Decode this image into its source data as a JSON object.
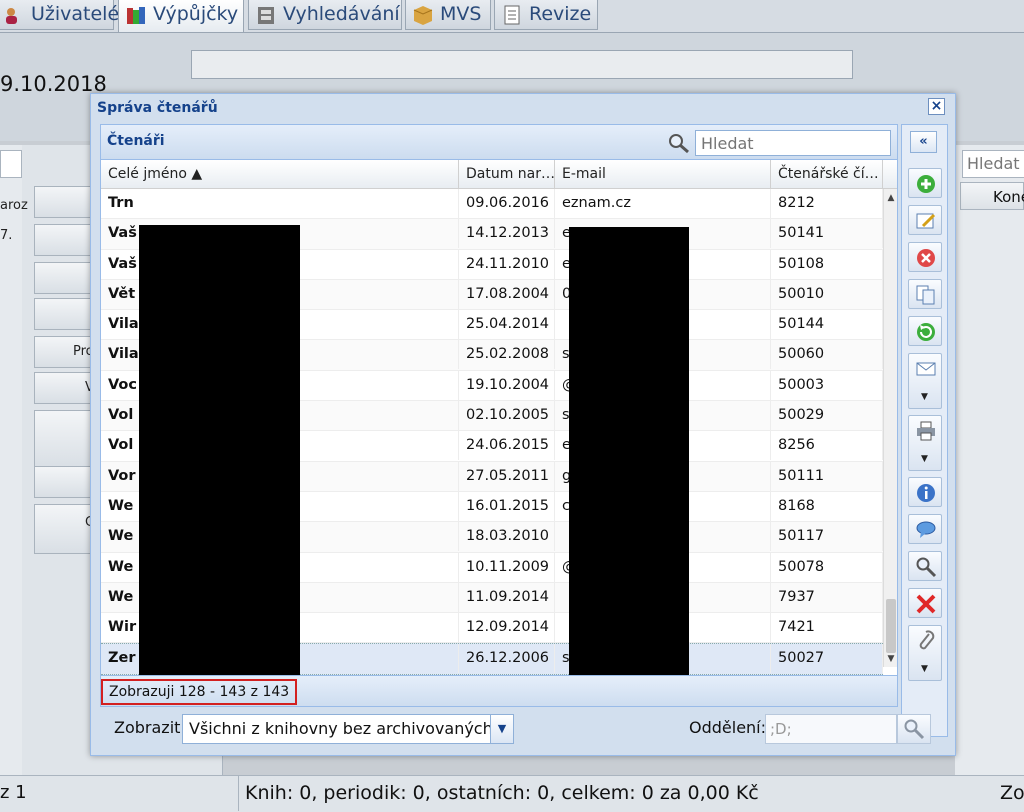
{
  "tabs": [
    {
      "label": "Uživatelé",
      "icon": "users-icon",
      "active": false
    },
    {
      "label": "Výpůjčky",
      "icon": "books-icon",
      "active": true
    },
    {
      "label": "Vyhledávání",
      "icon": "catalog-search-icon",
      "active": false
    },
    {
      "label": "MVS",
      "icon": "package-icon",
      "active": false
    },
    {
      "label": "Revize",
      "icon": "notepad-icon",
      "active": false
    }
  ],
  "background": {
    "date_fragment": "9.10.2018",
    "left_fragment_1": "aroz",
    "left_fragment_2": "7.",
    "side_fragment_1": "Pro",
    "side_fragment_2": "V",
    "side_fragment_3": "C",
    "right_search_placeholder": "Hledat",
    "right_column_header": "Kone",
    "status_left": "z 1",
    "status_main": "Knih: 0, periodik: 0, ostatních: 0, celkem: 0 za 0,00 Kč",
    "status_right": "Zo"
  },
  "dialog": {
    "title": "Správa čtenářů",
    "panel_title": "Čtenáři",
    "search_placeholder": "Hledat",
    "columns": [
      "Celé jméno ▲",
      "Datum nar…",
      "E-mail",
      "Čtenářské čí…"
    ],
    "rows": [
      {
        "name": "Trn",
        "date": "09.06.2016",
        "email": "eznam.cz",
        "card": "8212"
      },
      {
        "name": "Vaš",
        "date": "14.12.2013",
        "email": "eznam.cz",
        "card": "50141"
      },
      {
        "name": "Vaš",
        "date": "24.11.2010",
        "email": "eznam.cz",
        "card": "50108"
      },
      {
        "name": "Vět",
        "date": "17.08.2004",
        "email": "01@seznam...",
        "card": "50010"
      },
      {
        "name": "Vila",
        "date": "25.04.2014",
        "email": "",
        "card": "50144"
      },
      {
        "name": "Vila",
        "date": "25.02.2008",
        "email": "seznam.cz",
        "card": "50060"
      },
      {
        "name": "Voc",
        "date": "19.10.2004",
        "email": "@sedlcansk...",
        "card": "50003"
      },
      {
        "name": "Vol",
        "date": "02.10.2005",
        "email": "seznam.cz",
        "card": "50029"
      },
      {
        "name": "Vol",
        "date": "24.06.2015",
        "email": "eznam.cz",
        "card": "8256"
      },
      {
        "name": "Vor",
        "date": "27.05.2011",
        "email": "gmail.com",
        "card": "50111"
      },
      {
        "name": "We",
        "date": "16.01.2015",
        "email": "com",
        "card": "8168"
      },
      {
        "name": "We                                    a",
        "date": "18.03.2010",
        "email": "",
        "card": "50117"
      },
      {
        "name": "We                                   la",
        "date": "10.11.2009",
        "email": "@seznam.cz",
        "card": "50078"
      },
      {
        "name": "We",
        "date": "11.09.2014",
        "email": "",
        "card": "7937"
      },
      {
        "name": "Wir",
        "date": "12.09.2014",
        "email": "",
        "card": "7421"
      },
      {
        "name": "Zer",
        "date": "26.12.2006",
        "email": "seznam.cz",
        "card": "50027"
      }
    ],
    "selected_row_index": 15,
    "pager_text": "Zobrazuji 128 - 143 z 143",
    "filter_label": "Zobrazit:",
    "filter_value": "Všichni z knihovny bez archivovaných",
    "department_label": "Oddělení:",
    "department_placeholder": ";D;",
    "toolbar": [
      "add-icon",
      "edit-icon",
      "delete-icon",
      "copy-icon",
      "refresh-icon",
      "mail-icon",
      "print-icon",
      "info-icon",
      "message-icon",
      "search-icon",
      "close-red-icon",
      "attach-icon"
    ]
  }
}
